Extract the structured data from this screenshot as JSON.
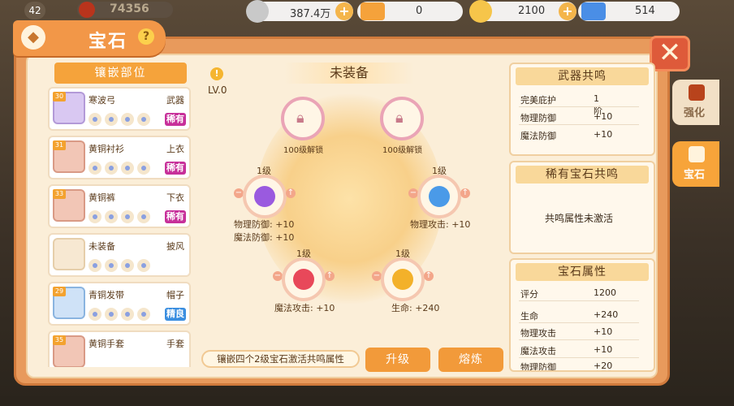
{
  "topbar": {
    "level": "42",
    "power_value": "74356",
    "silver_amount": "387.4万",
    "ticket_orange_amount": "0",
    "gold_amount": "2100",
    "ticket_blue_amount": "514"
  },
  "window": {
    "title": "宝石",
    "help": "?"
  },
  "left": {
    "header": "镶嵌部位",
    "slots": [
      {
        "level": "30",
        "name": "寒波弓",
        "type": "武器",
        "rarity": "稀有",
        "rarity_kind": "rare"
      },
      {
        "level": "31",
        "name": "黄铜衬衫",
        "type": "上衣",
        "rarity": "稀有",
        "rarity_kind": "rare"
      },
      {
        "level": "33",
        "name": "黄铜裤",
        "type": "下衣",
        "rarity": "稀有",
        "rarity_kind": "rare"
      },
      {
        "level": "",
        "name": "未装备",
        "type": "披风",
        "rarity": "",
        "rarity_kind": ""
      },
      {
        "level": "29",
        "name": "青铜发带",
        "type": "帽子",
        "rarity": "精良",
        "rarity_kind": "good"
      },
      {
        "level": "35",
        "name": "黄铜手套",
        "type": "手套",
        "rarity": "",
        "rarity_kind": ""
      }
    ]
  },
  "center": {
    "lv_text": "LV.0",
    "title": "未装备",
    "nodes": [
      {
        "label": "100级解锁"
      },
      {
        "label": "100级解锁"
      },
      {
        "level": "1级",
        "stat1": "物理防御: +10",
        "stat2": "魔法防御: +10"
      },
      {
        "level": "1级",
        "stat1": "物理攻击: +10"
      },
      {
        "level": "1级",
        "stat1": "魔法攻击: +10"
      },
      {
        "level": "1级",
        "stat1": "生命: +240"
      }
    ],
    "hint": "镶嵌四个2级宝石激活共鸣属性",
    "upgrade_label": "升级",
    "smelt_label": "熔炼"
  },
  "right": {
    "weapon_resonance": {
      "title": "武器共鸣",
      "rows": [
        {
          "k": "完美庇护",
          "v": "1阶"
        },
        {
          "k": "物理防御",
          "v": "+10"
        },
        {
          "k": "魔法防御",
          "v": "+10"
        }
      ]
    },
    "rare_resonance": {
      "title": "稀有宝石共鸣",
      "status": "共鸣属性未激活"
    },
    "gem_attrs": {
      "title": "宝石属性",
      "rows": [
        {
          "k": "评分",
          "v": "1200"
        },
        {
          "k": "生命",
          "v": "+240"
        },
        {
          "k": "物理攻击",
          "v": "+10"
        },
        {
          "k": "魔法攻击",
          "v": "+10"
        },
        {
          "k": "物理防御",
          "v": "+20"
        }
      ]
    }
  },
  "side_tabs": [
    {
      "label": "强化"
    },
    {
      "label": "宝石"
    }
  ]
}
